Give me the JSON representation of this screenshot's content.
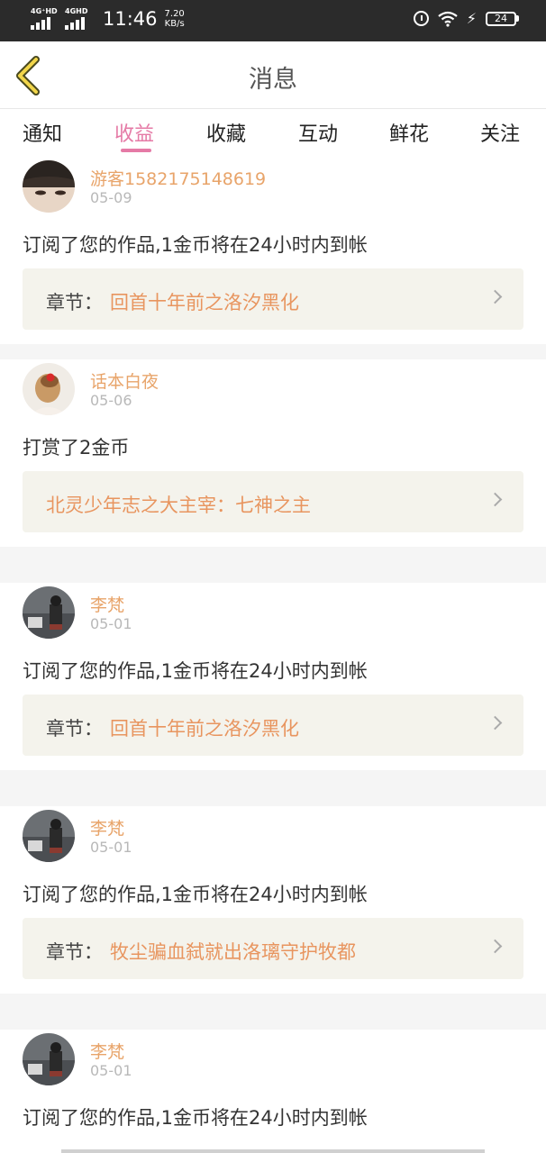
{
  "statusbar": {
    "net1": "4G⁺HD",
    "net2": "4GHD",
    "time": "11:46",
    "speed_value": "7.20",
    "speed_unit": "KB/s",
    "battery": "24",
    "icons": [
      "signal-icon",
      "signal-icon",
      "alarm-icon",
      "wifi-icon",
      "charging-icon",
      "battery-icon"
    ]
  },
  "header": {
    "title": "消息",
    "back_icon": "chevron-left-icon"
  },
  "tabs": [
    {
      "label": "通知"
    },
    {
      "label": "收益",
      "active": true
    },
    {
      "label": "收藏"
    },
    {
      "label": "互动"
    },
    {
      "label": "鲜花"
    },
    {
      "label": "关注"
    }
  ],
  "colors": {
    "accent": "#e57aa6",
    "username": "#e8a46a",
    "work_title": "#e8955f",
    "box_bg": "#f4f3ec"
  },
  "messages": [
    {
      "user": "游客1582175148619",
      "date": "05-09",
      "text": "订阅了您的作品,1金币将在24小时内到帐",
      "prefix": "章节：",
      "work": "回首十年前之洛汐黑化"
    },
    {
      "user": "话本白夜",
      "date": "05-06",
      "text": "打赏了2金币",
      "prefix": "",
      "work": "北灵少年志之大主宰：七神之主"
    },
    {
      "user": "李梵",
      "date": "05-01",
      "text": "订阅了您的作品,1金币将在24小时内到帐",
      "prefix": "章节：",
      "work": "回首十年前之洛汐黑化"
    },
    {
      "user": "李梵",
      "date": "05-01",
      "text": "订阅了您的作品,1金币将在24小时内到帐",
      "prefix": "章节：",
      "work": "牧尘骗血弑就出洛璃守护牧都"
    },
    {
      "user": "李梵",
      "date": "05-01",
      "text": "订阅了您的作品,1金币将在24小时内到帐"
    }
  ]
}
